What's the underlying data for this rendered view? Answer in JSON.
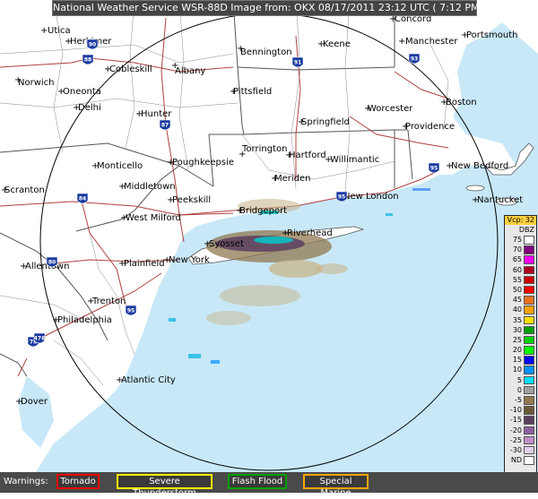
{
  "title": "National Weather Service WSR-88D Image from:  OKX 08/17/2011  23:12 UTC  ( 7:12 PM EDT)",
  "cities": [
    {
      "name": "Utica"
    },
    {
      "name": "Herkimer"
    },
    {
      "name": "Bennington"
    },
    {
      "name": "Keene"
    },
    {
      "name": "Concord"
    },
    {
      "name": "Manchester"
    },
    {
      "name": "Portsmouth"
    },
    {
      "name": "Cobleskill"
    },
    {
      "name": "Albany"
    },
    {
      "name": "Norwich"
    },
    {
      "name": "Oneonta"
    },
    {
      "name": "Delhi"
    },
    {
      "name": "Pittsfield"
    },
    {
      "name": "Worcester"
    },
    {
      "name": "Boston"
    },
    {
      "name": "Hunter"
    },
    {
      "name": "Springfield"
    },
    {
      "name": "Torrington"
    },
    {
      "name": "Hartford"
    },
    {
      "name": "Willimantic"
    },
    {
      "name": "Providence"
    },
    {
      "name": "New Bedford"
    },
    {
      "name": "Monticello"
    },
    {
      "name": "Poughkeepsie"
    },
    {
      "name": "Meriden"
    },
    {
      "name": "Middletown"
    },
    {
      "name": "Scranton"
    },
    {
      "name": "Peekskill"
    },
    {
      "name": "Bridgeport"
    },
    {
      "name": "New London"
    },
    {
      "name": "Nantucket"
    },
    {
      "name": "West Milford"
    },
    {
      "name": "Syosset"
    },
    {
      "name": "Riverhead"
    },
    {
      "name": "Allentown"
    },
    {
      "name": "Plainfield"
    },
    {
      "name": "New York"
    },
    {
      "name": "Trenton"
    },
    {
      "name": "Philadelphia"
    },
    {
      "name": "Atlantic City"
    },
    {
      "name": "Dover"
    }
  ],
  "highway_shields": [
    "88",
    "90",
    "91",
    "93",
    "87",
    "84",
    "95",
    "80",
    "78",
    "476",
    "95",
    "95"
  ],
  "legend": {
    "header": "Vcp: 32",
    "unit": "DBZ",
    "entries": [
      {
        "label": "75",
        "color": "#ffffff"
      },
      {
        "label": "70",
        "color": "#800080"
      },
      {
        "label": "65",
        "color": "#ff00ff"
      },
      {
        "label": "60",
        "color": "#b00020"
      },
      {
        "label": "55",
        "color": "#d00000"
      },
      {
        "label": "50",
        "color": "#ff0000"
      },
      {
        "label": "45",
        "color": "#e87020"
      },
      {
        "label": "40",
        "color": "#ffa000"
      },
      {
        "label": "35",
        "color": "#ffe000"
      },
      {
        "label": "30",
        "color": "#00a000"
      },
      {
        "label": "25",
        "color": "#00d000"
      },
      {
        "label": "20",
        "color": "#00ff00"
      },
      {
        "label": "15",
        "color": "#0000ff"
      },
      {
        "label": "10",
        "color": "#0090ff"
      },
      {
        "label": "5",
        "color": "#00e0ff"
      },
      {
        "label": "0",
        "color": "#a0a0a0"
      },
      {
        "label": "-5",
        "color": "#907850"
      },
      {
        "label": "-10",
        "color": "#6a5a3a"
      },
      {
        "label": "-15",
        "color": "#5a4060"
      },
      {
        "label": "-20",
        "color": "#9060a0"
      },
      {
        "label": "-25",
        "color": "#c090c8"
      },
      {
        "label": "-30",
        "color": "#e0d0e8"
      },
      {
        "label": "ND",
        "color": "#ffffff"
      }
    ]
  },
  "warnings": {
    "label": "Warnings:",
    "items": [
      {
        "label": "Tornado",
        "color": "#ff0000"
      },
      {
        "label": "Severe Thunderstorm",
        "color": "#ffff00"
      },
      {
        "label": "Flash Flood",
        "color": "#00a000"
      },
      {
        "label": "Special Marine",
        "color": "#ffa500"
      }
    ]
  },
  "colors": {
    "ocean": "#c8e8f8",
    "land": "#ffffff",
    "borders": "#555555",
    "roads": "#b00000",
    "range_ring": "#000000"
  }
}
